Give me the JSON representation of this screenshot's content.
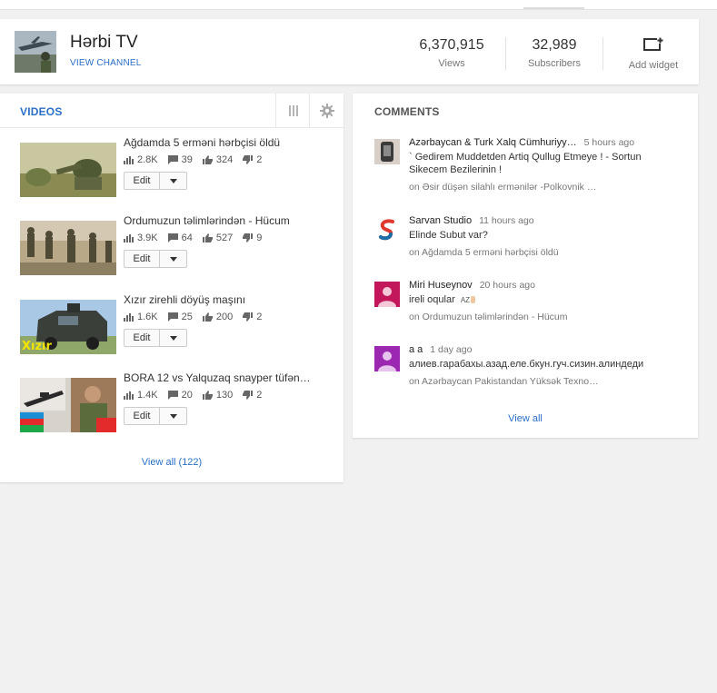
{
  "channel": {
    "title": "Hərbi TV",
    "view_channel": "VIEW CHANNEL",
    "stats": [
      {
        "value": "6,370,915",
        "label": "Views"
      },
      {
        "value": "32,989",
        "label": "Subscribers"
      }
    ],
    "widget_label": "Add widget"
  },
  "videos": {
    "title": "VIDEOS",
    "items": [
      {
        "title": "Ağdamda 5 erməni hərbçisi öldü",
        "views": "2.8K",
        "comments": "39",
        "likes": "324",
        "dislikes": "2",
        "edit": "Edit"
      },
      {
        "title": "Ordumuzun təlimlərindən - Hücum",
        "views": "3.9K",
        "comments": "64",
        "likes": "527",
        "dislikes": "9",
        "edit": "Edit"
      },
      {
        "title": "Xızır zirehli döyüş maşını",
        "views": "1.6K",
        "comments": "25",
        "likes": "200",
        "dislikes": "2",
        "edit": "Edit",
        "thumb_text": "Xızır"
      },
      {
        "title": "BORA 12 vs Yalquzaq snayper tüfən…",
        "views": "1.4K",
        "comments": "20",
        "likes": "130",
        "dislikes": "2",
        "edit": "Edit"
      }
    ],
    "view_all": "View all (122)"
  },
  "comments": {
    "title": "COMMENTS",
    "items": [
      {
        "author": "Azərbaycan & Turk Xalq Cümhuriyy…",
        "time": "5 hours ago",
        "text": "` Gedirem Muddetden Artiq Qullug Etmeye ! - Sortun Sikecem Bezilerinin !",
        "on": "on Əsir düşən silahlı ermənilər -Polkovnik …"
      },
      {
        "author": "Sarvan Studio",
        "time": "11 hours ago",
        "text": "Elinde Subut var?",
        "on": "on Ağdamda 5 erməni hərbçisi öldü"
      },
      {
        "author": "Miri Huseynov",
        "time": "20 hours ago",
        "text": "ireli oqular",
        "badge": "AZ",
        "on": "on Ordumuzun təlimlərindən - Hücum"
      },
      {
        "author": "a a",
        "time": "1 day ago",
        "text": "алиев.гарабахы.азад.еле.бкун.гуч.сизин.алиндеди",
        "on": "on Azərbaycan Pakistandan Yüksək Texno…"
      }
    ],
    "view_all": "View all"
  },
  "colors": {
    "link": "#2a6fc8",
    "avatar_purple": "#9c27b0",
    "avatar_pink": "#c2185b"
  }
}
